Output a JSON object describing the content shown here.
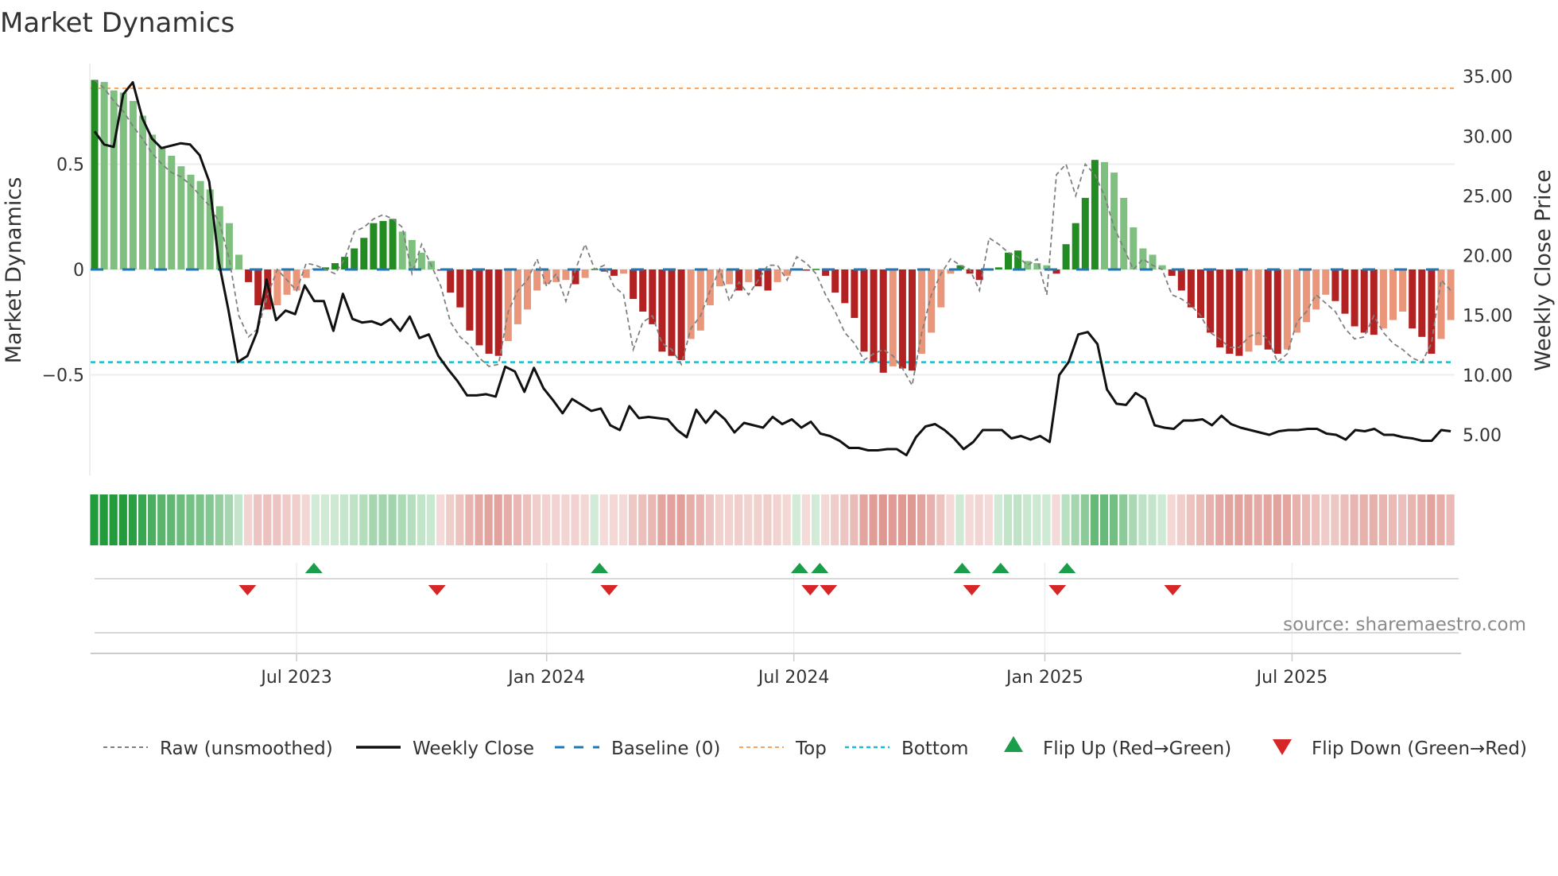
{
  "chart_data": {
    "type": "bar",
    "title": "Market Dynamics",
    "ylabel_left": "Market Dynamics",
    "ylabel_right": "Weekly Close Price",
    "source": "source: sharemaestro.com",
    "left_axis": {
      "ylim": [
        -0.78,
        1.0
      ],
      "ticks": [
        0.5,
        0,
        -0.5
      ],
      "tick_labels": [
        "0.5",
        "0",
        "−0.5"
      ]
    },
    "right_axis": {
      "ylim": [
        1.0,
        36.5
      ],
      "ticks": [
        35,
        30,
        25,
        20,
        15,
        10,
        5
      ],
      "tick_labels": [
        "35.00",
        "30.00",
        "25.00",
        "20.00",
        "15.00",
        "10.00",
        "5.00"
      ]
    },
    "x_ticks": [
      {
        "label": "Jul 2023",
        "week": 21
      },
      {
        "label": "Jan 2024",
        "week": 47
      },
      {
        "label": "Jul 2024",
        "week": 72.7
      },
      {
        "label": "Jan 2025",
        "week": 98.8
      },
      {
        "label": "Jul 2025",
        "week": 124.5
      }
    ],
    "top_threshold": 0.86,
    "bottom_threshold": -0.44,
    "grid": true,
    "legend_position": "bottom",
    "colors": {
      "green_strong": "#228b22",
      "green_light": "#7fbf7f",
      "red_strong": "#b22222",
      "red_light": "#e9967a",
      "baseline": "#1f77b4",
      "top": "#f4a460",
      "bottom": "#17becf",
      "raw": "#808080",
      "close": "#111111",
      "flip_up": "#1a9e4a",
      "flip_down": "#d62728"
    },
    "dynamics": [
      0.9,
      0.89,
      0.85,
      0.84,
      0.8,
      0.73,
      0.64,
      0.58,
      0.54,
      0.49,
      0.45,
      0.42,
      0.38,
      0.3,
      0.22,
      0.07,
      -0.06,
      -0.17,
      -0.19,
      -0.17,
      -0.12,
      -0.1,
      -0.04,
      0.005,
      0.01,
      0.03,
      0.06,
      0.1,
      0.15,
      0.22,
      0.23,
      0.24,
      0.18,
      0.14,
      0.08,
      0.04,
      -0.005,
      -0.11,
      -0.18,
      -0.29,
      -0.36,
      -0.4,
      -0.41,
      -0.34,
      -0.26,
      -0.19,
      -0.1,
      -0.07,
      -0.06,
      -0.05,
      -0.07,
      -0.04,
      0.003,
      -0.01,
      -0.03,
      -0.02,
      -0.14,
      -0.2,
      -0.26,
      -0.39,
      -0.41,
      -0.43,
      -0.33,
      -0.29,
      -0.17,
      -0.08,
      -0.07,
      -0.1,
      -0.06,
      -0.08,
      -0.1,
      -0.06,
      -0.03,
      0.003,
      -0.003,
      0.003,
      -0.03,
      -0.11,
      -0.16,
      -0.23,
      -0.39,
      -0.44,
      -0.49,
      -0.46,
      -0.47,
      -0.48,
      -0.4,
      -0.3,
      -0.18,
      -0.02,
      0.02,
      -0.02,
      -0.05,
      -0.005,
      0.01,
      0.08,
      0.09,
      0.04,
      0.03,
      0.02,
      -0.02,
      0.12,
      0.22,
      0.34,
      0.52,
      0.51,
      0.46,
      0.34,
      0.2,
      0.1,
      0.07,
      0.02,
      -0.03,
      -0.1,
      -0.18,
      -0.23,
      -0.3,
      -0.37,
      -0.4,
      -0.41,
      -0.39,
      -0.36,
      -0.38,
      -0.4,
      -0.38,
      -0.3,
      -0.25,
      -0.19,
      -0.12,
      -0.15,
      -0.21,
      -0.27,
      -0.3,
      -0.31,
      -0.28,
      -0.24,
      -0.2,
      -0.28,
      -0.32,
      -0.4,
      -0.33,
      -0.24
    ],
    "raw": [
      0.9,
      0.86,
      0.8,
      0.75,
      0.68,
      0.62,
      0.55,
      0.5,
      0.46,
      0.44,
      0.4,
      0.35,
      0.3,
      0.22,
      0.05,
      -0.22,
      -0.32,
      -0.28,
      -0.12,
      0.0,
      -0.05,
      -0.1,
      0.03,
      0.02,
      0.0,
      -0.02,
      0.05,
      0.18,
      0.2,
      0.24,
      0.26,
      0.24,
      0.2,
      -0.02,
      0.12,
      0.02,
      -0.08,
      -0.25,
      -0.32,
      -0.36,
      -0.42,
      -0.46,
      -0.45,
      -0.2,
      -0.1,
      -0.05,
      0.05,
      -0.08,
      -0.02,
      -0.15,
      0.0,
      0.12,
      0.0,
      0.02,
      -0.08,
      -0.12,
      -0.38,
      -0.25,
      -0.22,
      -0.35,
      -0.38,
      -0.45,
      -0.28,
      -0.22,
      -0.1,
      0.0,
      -0.15,
      -0.06,
      -0.12,
      -0.05,
      0.02,
      0.02,
      -0.05,
      0.06,
      0.03,
      -0.02,
      -0.12,
      -0.2,
      -0.3,
      -0.35,
      -0.43,
      -0.4,
      -0.38,
      -0.41,
      -0.47,
      -0.55,
      -0.3,
      -0.12,
      -0.02,
      0.05,
      0.02,
      0.0,
      -0.1,
      0.15,
      0.12,
      0.08,
      0.06,
      0.02,
      0.05,
      -0.12,
      0.45,
      0.5,
      0.35,
      0.5,
      0.45,
      0.35,
      0.2,
      0.1,
      0.0,
      0.05,
      0.02,
      0.0,
      -0.12,
      -0.14,
      -0.17,
      -0.22,
      -0.3,
      -0.33,
      -0.37,
      -0.37,
      -0.32,
      -0.3,
      -0.33,
      -0.44,
      -0.4,
      -0.25,
      -0.2,
      -0.12,
      -0.16,
      -0.2,
      -0.28,
      -0.33,
      -0.32,
      -0.22,
      -0.3,
      -0.35,
      -0.38,
      -0.42,
      -0.44,
      -0.35,
      -0.05,
      -0.1
    ],
    "weekly_close": [
      30.4,
      29.3,
      29.1,
      33.5,
      34.5,
      31.5,
      29.8,
      29.0,
      29.2,
      29.4,
      29.3,
      28.4,
      26.2,
      19.5,
      15.5,
      11.1,
      11.6,
      13.6,
      18.0,
      14.6,
      15.4,
      15.1,
      17.5,
      16.2,
      16.2,
      13.7,
      16.8,
      14.7,
      14.4,
      14.5,
      14.2,
      14.7,
      13.7,
      14.9,
      13.1,
      13.4,
      11.6,
      10.5,
      9.5,
      8.3,
      8.3,
      8.4,
      8.2,
      10.7,
      10.3,
      8.6,
      10.6,
      8.9,
      7.9,
      6.8,
      8.0,
      7.5,
      7.0,
      7.2,
      5.8,
      5.4,
      7.4,
      6.4,
      6.5,
      6.4,
      6.3,
      5.4,
      4.8,
      7.1,
      6.0,
      7.0,
      6.3,
      5.2,
      6.0,
      5.8,
      5.6,
      6.5,
      5.9,
      6.3,
      5.6,
      6.1,
      5.1,
      4.9,
      4.5,
      3.9,
      3.9,
      3.7,
      3.7,
      3.8,
      3.8,
      3.3,
      4.8,
      5.7,
      5.9,
      5.4,
      4.7,
      3.8,
      4.4,
      5.4,
      5.4,
      5.4,
      4.7,
      4.9,
      4.6,
      4.9,
      4.4,
      10.0,
      11.1,
      13.4,
      13.6,
      12.6,
      8.8,
      7.6,
      7.5,
      8.5,
      8.0,
      5.8,
      5.6,
      5.5,
      6.2,
      6.2,
      6.3,
      5.8,
      6.6,
      5.9,
      5.6,
      5.4,
      5.2,
      5.0,
      5.3,
      5.4,
      5.4,
      5.5,
      5.5,
      5.1,
      5.0,
      4.6,
      5.4,
      5.3,
      5.5,
      5.0,
      5.0,
      4.8,
      4.7,
      4.5,
      4.5,
      5.4,
      5.3
    ],
    "flip_up_weeks": [
      22.8,
      52.5,
      73.3,
      75.4,
      90.2,
      94.2,
      101.1
    ],
    "flip_down_weeks": [
      15.9,
      35.6,
      53.5,
      74.4,
      76.3,
      91.2,
      100.1,
      112.1
    ],
    "legend": [
      {
        "key": "raw",
        "label": "Raw (unsmoothed)"
      },
      {
        "key": "close",
        "label": "Weekly Close"
      },
      {
        "key": "baseline",
        "label": "Baseline (0)"
      },
      {
        "key": "top",
        "label": "Top"
      },
      {
        "key": "bottom",
        "label": "Bottom"
      },
      {
        "key": "flip_up",
        "label": "Flip Up (Red→Green)"
      },
      {
        "key": "flip_down",
        "label": "Flip Down (Green→Red)"
      }
    ]
  }
}
